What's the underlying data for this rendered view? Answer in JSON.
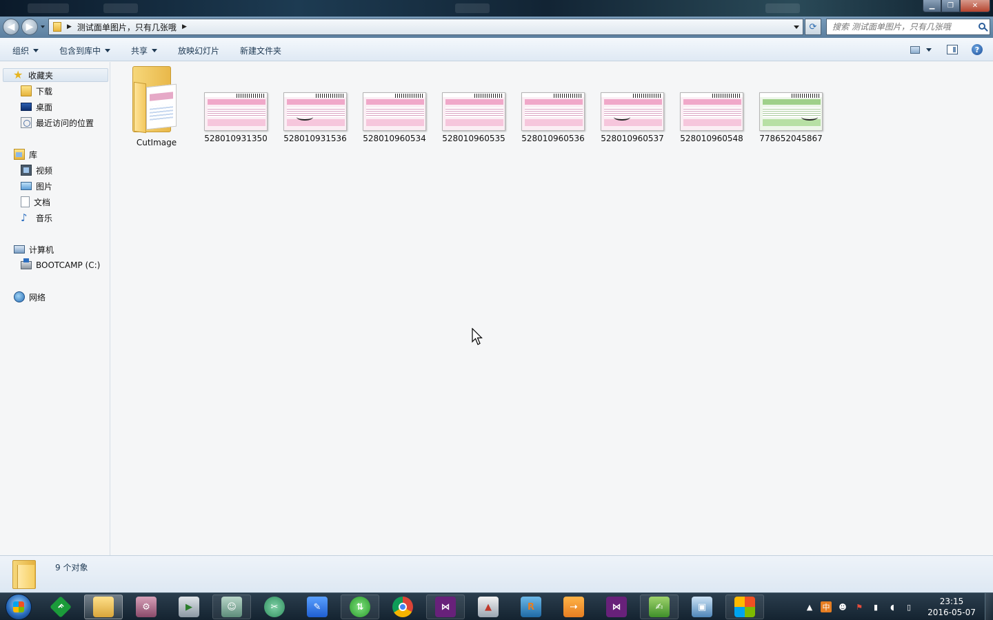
{
  "address": {
    "path_segments": [
      "测试面单图片，只有几张哦"
    ],
    "search_placeholder": "搜索 测试面单图片，只有几张哦"
  },
  "toolbar": {
    "organize": "组织",
    "include_in_library": "包含到库中",
    "share": "共享",
    "slideshow": "放映幻灯片",
    "new_folder": "新建文件夹"
  },
  "nav": {
    "favorites": "收藏夹",
    "downloads": "下载",
    "desktop": "桌面",
    "recent": "最近访问的位置",
    "libraries": "库",
    "videos": "视频",
    "pictures": "图片",
    "documents": "文档",
    "music": "音乐",
    "computer": "计算机",
    "drive_c": "BOOTCAMP (C:)",
    "network": "网络"
  },
  "items": [
    {
      "name": "CutImage",
      "type": "folder"
    },
    {
      "name": "528010931350",
      "type": "image"
    },
    {
      "name": "528010931536",
      "type": "image"
    },
    {
      "name": "528010960534",
      "type": "image"
    },
    {
      "name": "528010960535",
      "type": "image"
    },
    {
      "name": "528010960536",
      "type": "image"
    },
    {
      "name": "528010960537",
      "type": "image"
    },
    {
      "name": "528010960548",
      "type": "image"
    },
    {
      "name": "778652045867",
      "type": "image"
    }
  ],
  "details": {
    "count": "9 个对象"
  },
  "taskbar": {
    "time": "23:15",
    "date": "2016-05-07"
  },
  "colors": {
    "accent": "#1e3953",
    "taskbar": "#142330",
    "folder": "#e9b84a"
  }
}
